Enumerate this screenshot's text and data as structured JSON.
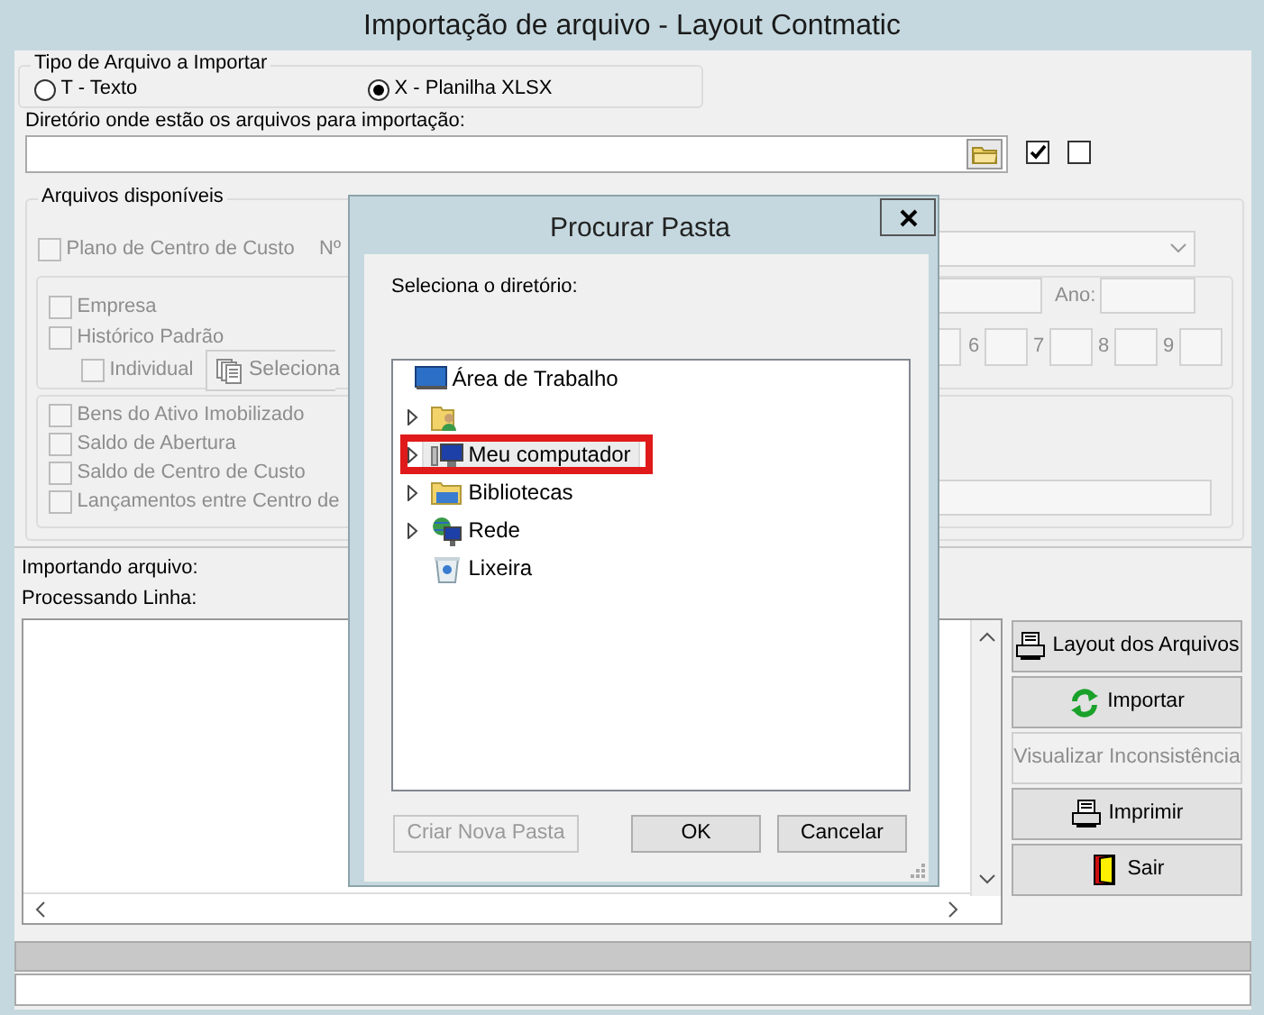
{
  "window": {
    "title": "Importação de arquivo - Layout Contmatic"
  },
  "file_type": {
    "legend": "Tipo de Arquivo a Importar",
    "options": [
      {
        "label": "T - Texto",
        "selected": false
      },
      {
        "label": "X - Planilha XLSX",
        "selected": true
      }
    ]
  },
  "directory": {
    "label": "Diretório onde estão os arquivos para importação:",
    "flags": [
      {
        "checked": true
      },
      {
        "checked": false
      }
    ]
  },
  "available": {
    "legend": "Arquivos disponíveis",
    "disabled": true,
    "plan": {
      "label": "Plano de Centro de Custo",
      "checked": false
    },
    "number_label": "Nº",
    "group_1": [
      {
        "kind": "check",
        "label": "Empresa",
        "checked": false
      },
      {
        "kind": "check",
        "label": "Histórico Padrão",
        "checked": false
      },
      {
        "kind": "sub",
        "label": "Individual",
        "checked": false,
        "button": "Seleciona"
      }
    ],
    "year_label": "Ano:",
    "digit_labels": [
      "6",
      "7",
      "8",
      "9"
    ],
    "group_2": [
      {
        "label": "Bens do Ativo Imobilizado",
        "checked": false
      },
      {
        "label": "Saldo de Abertura",
        "checked": false
      },
      {
        "label": "Saldo de Centro de Custo",
        "checked": false
      },
      {
        "label": "Lançamentos entre Centro de",
        "checked": false
      }
    ]
  },
  "progress": {
    "file_label": "Importando arquivo:",
    "line_label": "Processando Linha:"
  },
  "actions": [
    {
      "kind": "printer",
      "label": "Layout dos Arquivos",
      "disabled": false
    },
    {
      "kind": "refresh",
      "label": "Importar",
      "disabled": false
    },
    {
      "kind": "none",
      "label": "Visualizar Inconsistência",
      "disabled": true
    },
    {
      "kind": "printer",
      "label": "Imprimir",
      "disabled": false
    },
    {
      "kind": "door",
      "label": "Sair",
      "disabled": false
    }
  ],
  "dialog": {
    "title": "Procurar Pasta",
    "prompt": "Seleciona o diretório:",
    "tree": [
      {
        "kind": "desktop",
        "label": "Área de Trabalho",
        "expandable": false,
        "selected": false
      },
      {
        "kind": "user",
        "expandable": true,
        "selected": false
      },
      {
        "kind": "computer",
        "label": "Meu computador",
        "expandable": true,
        "selected": true
      },
      {
        "kind": "library",
        "label": "Bibliotecas",
        "expandable": true,
        "selected": false
      },
      {
        "kind": "network",
        "label": "Rede",
        "expandable": true,
        "selected": false
      },
      {
        "kind": "trash",
        "label": "Lixeira",
        "expandable": false,
        "selected": false
      }
    ],
    "buttons": [
      {
        "label": "Criar Nova Pasta",
        "disabled": true
      },
      {
        "label": "OK",
        "disabled": false
      },
      {
        "label": "Cancelar",
        "disabled": false
      }
    ]
  }
}
